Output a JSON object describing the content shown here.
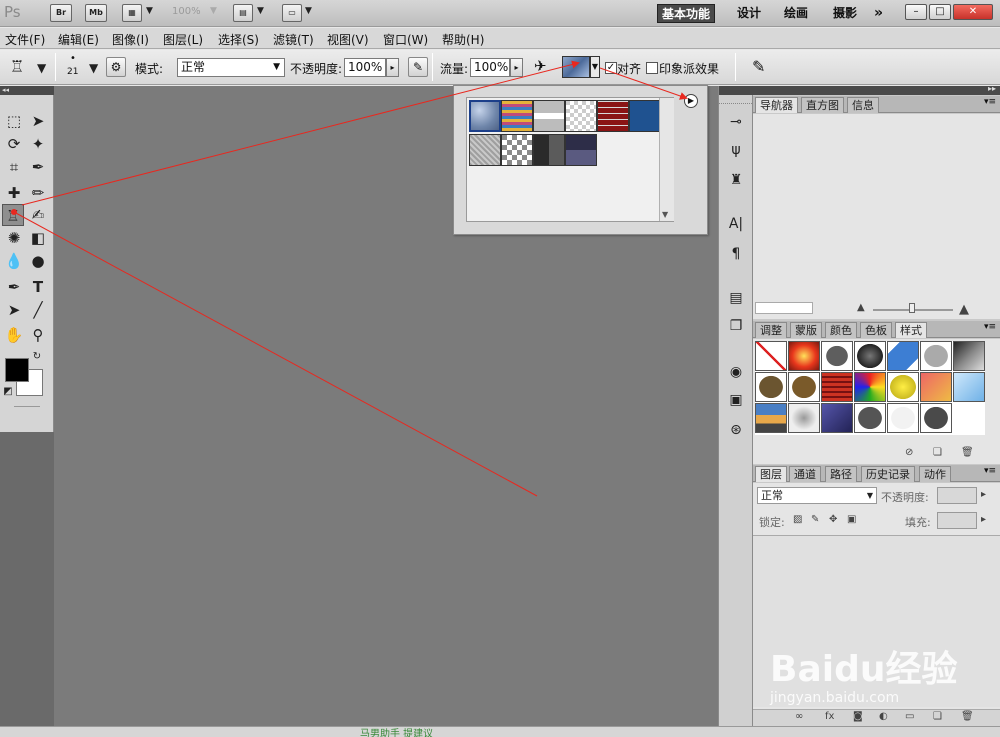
{
  "appbar": {
    "logo": "Ps",
    "bridge_label": "Br",
    "minibridge_label": "Mb",
    "zoom": "100%",
    "workspaces": [
      "基本功能",
      "设计",
      "绘画",
      "摄影"
    ],
    "more": "»"
  },
  "menu": [
    "文件(F)",
    "编辑(E)",
    "图像(I)",
    "图层(L)",
    "选择(S)",
    "滤镜(T)",
    "视图(V)",
    "窗口(W)",
    "帮助(H)"
  ],
  "options": {
    "brush_size": "21",
    "mode_label": "模式:",
    "mode_value": "正常",
    "opacity_label": "不透明度:",
    "opacity_value": "100%",
    "flow_label": "流量:",
    "flow_value": "100%",
    "align_label": "对齐",
    "impressionist_label": "印象派效果"
  },
  "navigator_tabs": [
    "导航器",
    "直方图",
    "信息"
  ],
  "adjust_tabs": [
    "调整",
    "蒙版",
    "颜色",
    "色板",
    "样式"
  ],
  "layers_tabs": [
    "图层",
    "通道",
    "路径",
    "历史记录",
    "动作"
  ],
  "layers": {
    "blend_mode": "正常",
    "opacity_label": "不透明度:",
    "lock_label": "锁定:",
    "fill_label": "填充:"
  },
  "watermark": {
    "brand": "Baidu经验",
    "url": "jingyan.baidu.com"
  },
  "bottom_text": "马男助手 提建议",
  "colors": {
    "annotation": "#e8281f",
    "canvas": "#7b7b7b",
    "panel_dark": "#4a4a4a"
  }
}
